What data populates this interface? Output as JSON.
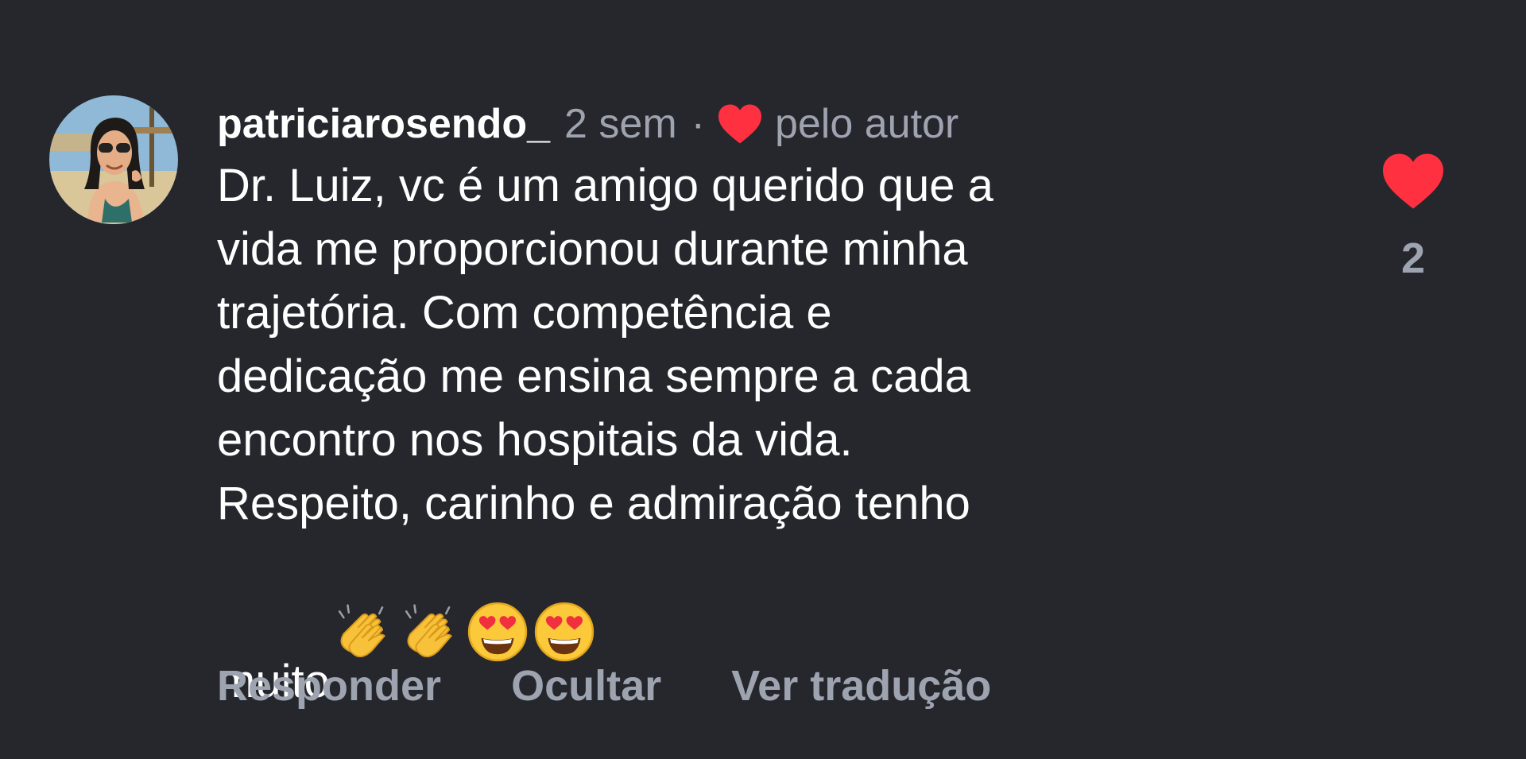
{
  "comment": {
    "username": "patriciarosendo_",
    "time": "2 sem",
    "separator": "·",
    "liked_by_author": "pelo autor",
    "text": "Dr. Luiz, vc é um amigo querido que a\nvida me proporcionou durante minha\ntrajetória. Com competência e\ndedicação me ensina sempre a cada\nencontro nos hospitais da vida.\nRespeito, carinho e admiração tenho\nmuito",
    "emojis": [
      "clapping-hands-icon",
      "clapping-hands-icon",
      "heart-eyes-face-icon",
      "heart-eyes-face-icon"
    ]
  },
  "like": {
    "icon": "heart-filled-icon",
    "count": "2"
  },
  "actions": {
    "reply": "Responder",
    "hide": "Ocultar",
    "translate": "Ver tradução"
  },
  "colors": {
    "background": "#25272d",
    "primary_text": "#ffffff",
    "secondary_text": "#9ea3b0",
    "heart": "#ff3040"
  }
}
